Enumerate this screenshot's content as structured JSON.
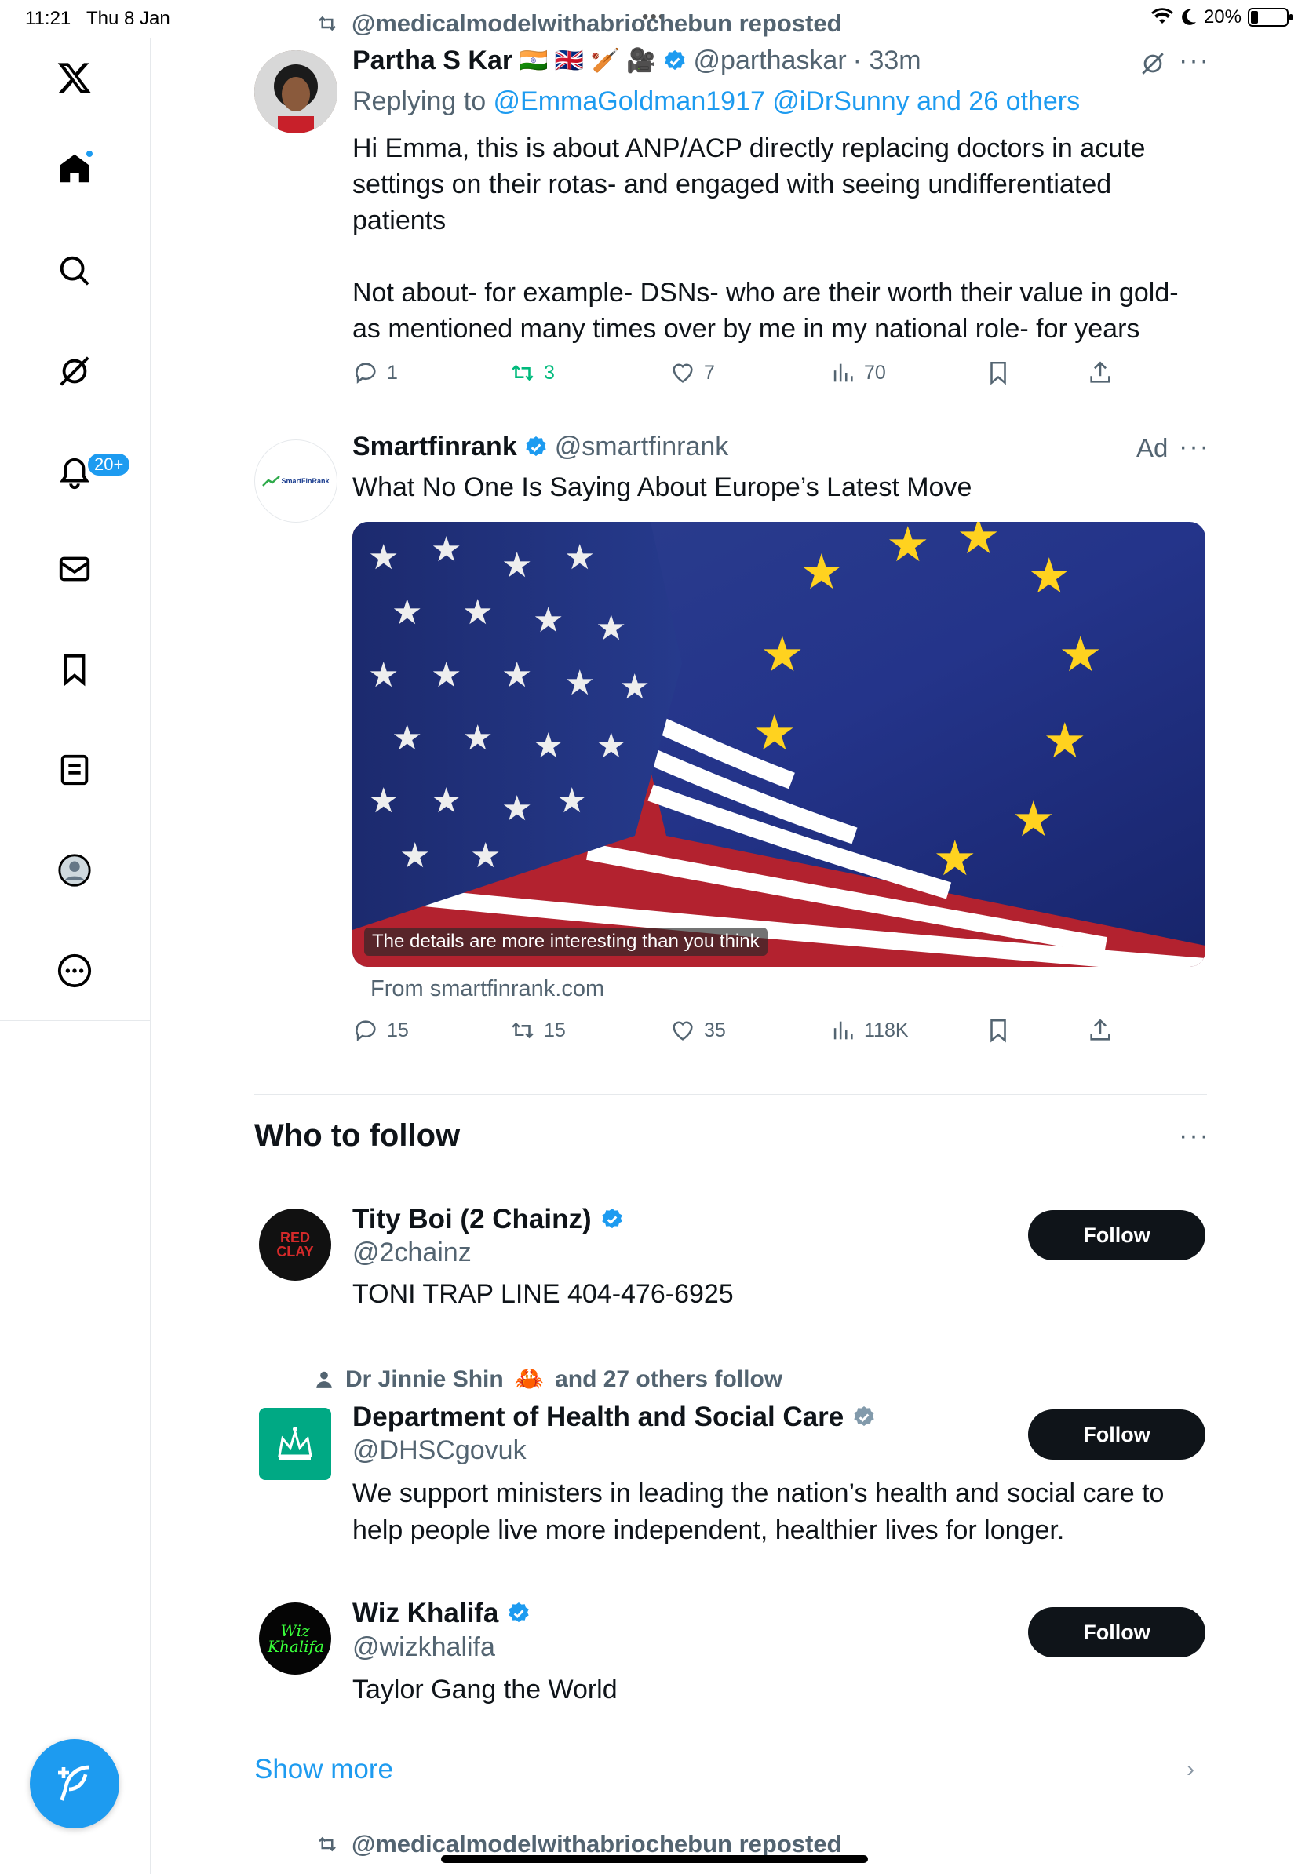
{
  "status_bar": {
    "time": "11:21",
    "date": "Thu 8 Jan",
    "battery": "20%",
    "battery_level": 0.2
  },
  "sidebar": {
    "items": [
      {
        "name": "home",
        "icon": "home-icon"
      },
      {
        "name": "explore",
        "icon": "search-icon"
      },
      {
        "name": "grok",
        "icon": "grok-icon"
      },
      {
        "name": "notifications",
        "icon": "bell-icon",
        "badge": "20+"
      },
      {
        "name": "messages",
        "icon": "envelope-icon"
      },
      {
        "name": "bookmarks",
        "icon": "bookmark-icon"
      },
      {
        "name": "lists",
        "icon": "list-icon"
      },
      {
        "name": "profile",
        "icon": "profile-icon"
      },
      {
        "name": "more",
        "icon": "more-circle-icon"
      }
    ],
    "compose_icon": "feather-plus-icon"
  },
  "tweet1": {
    "repost_label": "@medicalmodelwithabriochebun reposted",
    "name": "Partha S Kar",
    "flags": "🇮🇳 🇬🇧 🏏 🎥",
    "handle": "@parthaskar",
    "time": "· 33m",
    "replying_prefix": "Replying to ",
    "replying_to": "@EmmaGoldman1917 @iDrSunny and 26 others",
    "text": "Hi Emma, this is about ANP/ACP directly replacing doctors in acute settings on their rotas- and engaged with seeing undifferentiated patients\n\nNot about- for example- DSNs- who are their worth their value in gold- as mentioned many times over by me in my national role- for years",
    "replies": "1",
    "reposts": "3",
    "likes": "7",
    "views": "70"
  },
  "ad": {
    "name": "Smartfinrank",
    "handle": "@smartfinrank",
    "ad_label": "Ad",
    "avatar_text": "SmartFinRank",
    "text": "What No One Is Saying About Europe’s Latest Move",
    "image_caption": "The details are more interesting than you think",
    "from": "From smartfinrank.com",
    "replies": "15",
    "reposts": "15",
    "likes": "35",
    "views": "118K"
  },
  "who_to_follow": {
    "title": "Who to follow",
    "follow_label": "Follow",
    "show_more": "Show more",
    "accounts": [
      {
        "name": "Tity Boi (2 Chainz)",
        "handle": "@2chainz",
        "bio": "TONI TRAP LINE 404-476-6925",
        "avatar_text": "RED CLAY"
      },
      {
        "context_a": "Dr Jinnie Shin",
        "context_emoji": "🦀",
        "context_b": "and 27 others follow",
        "name": "Department of Health and Social Care",
        "handle": "@DHSCgovuk",
        "bio": "We support ministers in leading the nation’s health and social care to help people live more independent, healthier lives for longer."
      },
      {
        "name": "Wiz Khalifa",
        "handle": "@wizkhalifa",
        "bio": "Taylor Gang the World",
        "avatar_text": "Wiz Khalifa"
      }
    ]
  },
  "next_repost_label": "@medicalmodelwithabriochebun reposted",
  "colors": {
    "accent": "#1d9bf0",
    "repost_green": "#00ba7c",
    "text_secondary": "#536471"
  }
}
